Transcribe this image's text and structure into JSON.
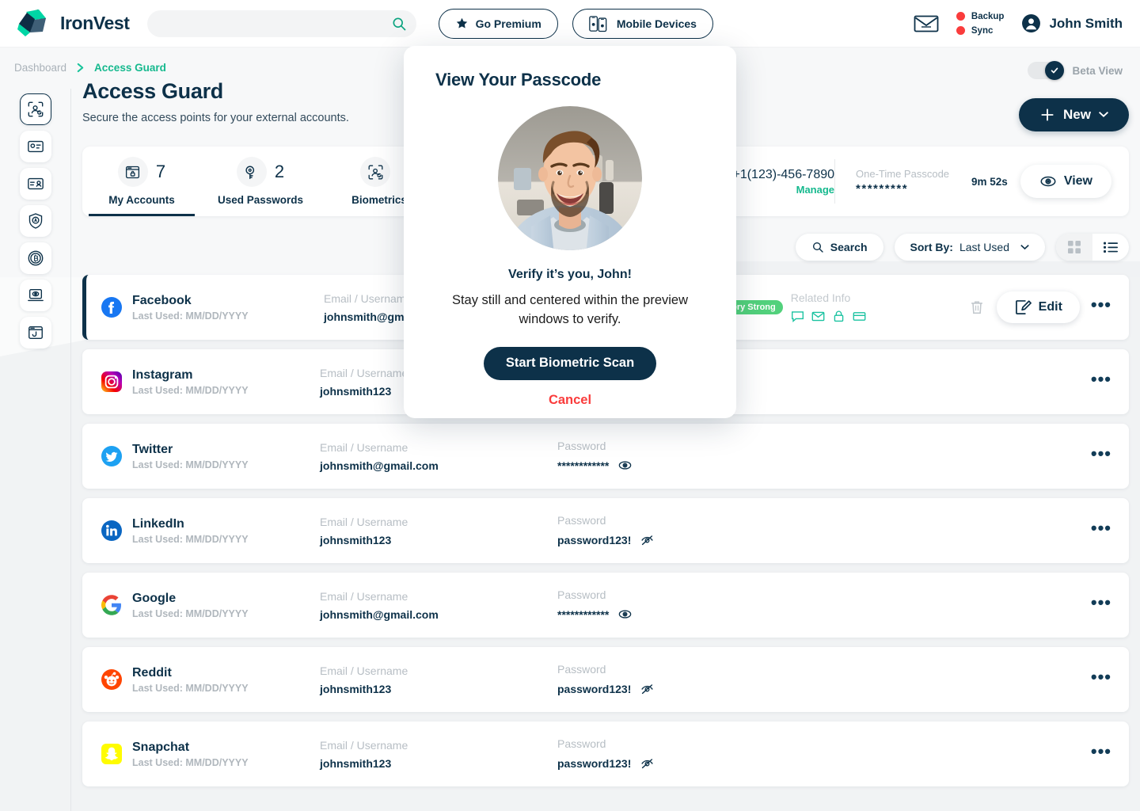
{
  "header": {
    "logo_text": "IronVest",
    "search_placeholder": "",
    "search_value": "",
    "buttons": [
      {
        "label": "Go Premium",
        "icon": "star-icon"
      },
      {
        "label": "Mobile Devices",
        "icon": "mobile-devices-icon"
      }
    ],
    "mail_icon": "envelope-icon",
    "statuses": [
      {
        "label": "Backup",
        "color": "#fa3c3c"
      },
      {
        "label": "Sync",
        "color": "#fa3c3c"
      }
    ],
    "user_name": "John Smith",
    "avatar_icon": "user-circle-icon"
  },
  "breadcrumb": {
    "root": "Dashboard",
    "separator": "chevron-right-icon",
    "current": "Access Guard"
  },
  "beta": {
    "label": "Beta View",
    "enabled": true,
    "check_icon": "check-icon"
  },
  "sidebar": {
    "items": [
      {
        "name": "access-guard",
        "icon": "biometric-scan-icon",
        "active": true
      },
      {
        "name": "payment-cards",
        "icon": "card-icon",
        "active": false
      },
      {
        "name": "identity",
        "icon": "id-card-icon",
        "active": false
      },
      {
        "name": "shield",
        "icon": "shield-a-icon",
        "active": false
      },
      {
        "name": "crypto",
        "icon": "bitcoin-icon",
        "active": false
      },
      {
        "name": "privacy",
        "icon": "laptop-eye-icon",
        "active": false
      },
      {
        "name": "phishing",
        "icon": "browser-hook-icon",
        "active": false
      }
    ]
  },
  "page": {
    "title": "Access Guard",
    "subtitle": "Secure the access points for your external accounts.",
    "new_button": {
      "label": "New",
      "plus_icon": "plus-icon",
      "caret_icon": "caret-down-icon"
    }
  },
  "stats": {
    "tabs": [
      {
        "label": "My Accounts",
        "value": "7",
        "icon": "browser-lock-icon",
        "active": true
      },
      {
        "label": "Used Passwords",
        "value": "2",
        "icon": "lock-key-icon",
        "active": false
      },
      {
        "label": "Biometrics",
        "value": "",
        "icon": "biometric-scan-icon",
        "active": false
      }
    ],
    "phone": {
      "number": "+1(123)-456-7890",
      "manage_label": "Manage"
    },
    "otp": {
      "label": "One-Time Passcode",
      "masked": "*********",
      "timer": "9m 52s",
      "view_label": "View",
      "view_icon": "eye-icon"
    }
  },
  "toolbar": {
    "search_label": "Search",
    "search_icon": "search-icon",
    "sort_prefix": "Sort By:",
    "sort_value": "Last Used",
    "sort_caret": "caret-down-icon",
    "grid_view_icon": "grid-view-icon",
    "list_view_icon": "list-view-icon",
    "active_view": "list"
  },
  "list": {
    "labels": {
      "username": "Email / Username",
      "password": "Password",
      "related": "Related Info"
    },
    "rows": [
      {
        "brand": "Facebook",
        "brand_key": "facebook",
        "last_used": "Last Used: MM/DD/YYYY",
        "username": "johnsmith@gm",
        "password": "",
        "password_revealed": false,
        "selected": true,
        "strength_badge": "Very Strong",
        "related_icons": [
          "note-icon",
          "email-icon",
          "lock-icon",
          "card-icon"
        ],
        "actions": {
          "delete_icon": "trash-icon",
          "edit_label": "Edit",
          "edit_icon": "pencil-square-icon",
          "more_icon": "more-dots-icon"
        }
      },
      {
        "brand": "Instagram",
        "brand_key": "instagram",
        "last_used": "Last Used: MM/DD/YYYY",
        "username": "johnsmith123",
        "password": "",
        "password_revealed": false,
        "selected": false,
        "actions": {
          "more_icon": "more-dots-icon"
        }
      },
      {
        "brand": "Twitter",
        "brand_key": "twitter",
        "last_used": "Last Used: MM/DD/YYYY",
        "username": "johnsmith@gmail.com",
        "password": "************",
        "password_revealed": false,
        "selected": false,
        "actions": {
          "more_icon": "more-dots-icon"
        }
      },
      {
        "brand": "LinkedIn",
        "brand_key": "linkedin",
        "last_used": "Last Used: MM/DD/YYYY",
        "username": "johnsmith123",
        "password": "password123!",
        "password_revealed": true,
        "selected": false,
        "actions": {
          "more_icon": "more-dots-icon"
        }
      },
      {
        "brand": "Google",
        "brand_key": "google",
        "last_used": "Last Used: MM/DD/YYYY",
        "username": "johnsmith@gmail.com",
        "password": "************",
        "password_revealed": false,
        "selected": false,
        "actions": {
          "more_icon": "more-dots-icon"
        }
      },
      {
        "brand": "Reddit",
        "brand_key": "reddit",
        "last_used": "Last Used: MM/DD/YYYY",
        "username": "johnsmith123",
        "password": "password123!",
        "password_revealed": true,
        "selected": false,
        "actions": {
          "more_icon": "more-dots-icon"
        }
      },
      {
        "brand": "Snapchat",
        "brand_key": "snapchat",
        "last_used": "Last Used: MM/DD/YYYY",
        "username": "johnsmith123",
        "password": "password123!",
        "password_revealed": true,
        "selected": false,
        "actions": {
          "more_icon": "more-dots-icon"
        }
      }
    ]
  },
  "modal": {
    "title": "View Your Passcode",
    "avatar_alt": "user-photo",
    "verify_text": "Verify it’s you, John!",
    "description": "Stay still and centered within the preview windows to verify.",
    "primary_label": "Start Biometric Scan",
    "cancel_label": "Cancel"
  },
  "colors": {
    "brand_navy": "#0d3149",
    "accent_teal": "#16b98e",
    "danger_red": "#fa3c3c",
    "badge_green": "#52d17c"
  }
}
